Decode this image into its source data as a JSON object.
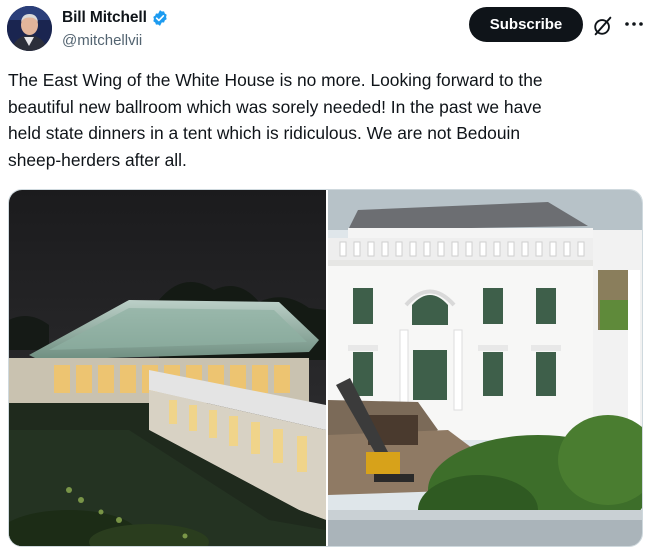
{
  "author": {
    "display_name": "Bill Mitchell",
    "handle": "@mitchellvii",
    "verified": true,
    "verified_color": "#1d9bf0"
  },
  "actions": {
    "subscribe_label": "Subscribe",
    "grok_icon": "slashed-circle-icon",
    "more_icon": "more-horizontal-icon"
  },
  "tweet": {
    "text": "The East Wing of the White House is no more.  Looking forward to the\nbeautiful new ballroom which was sorely needed!  In the past we have\nheld state dinners in a tent which is ridiculous. We are not Bedouin\nsheep-herders after all."
  },
  "media": {
    "images": [
      {
        "subject": "illuminated white event tent at night"
      },
      {
        "subject": "White House facade with demolition rubble and excavator"
      }
    ]
  }
}
